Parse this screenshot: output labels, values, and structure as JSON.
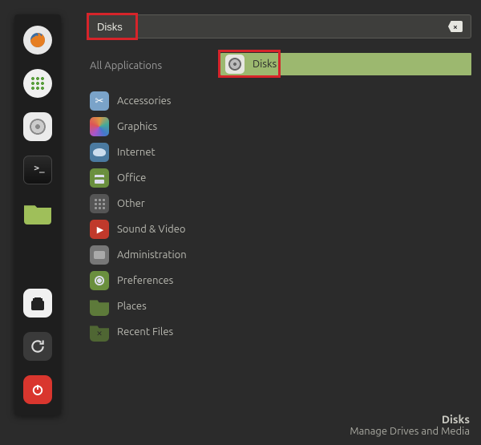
{
  "search": {
    "value": "Disks"
  },
  "categories": [
    {
      "label": "All Applications",
      "icon": ""
    },
    {
      "label": "Accessories",
      "icon": "i-scissors"
    },
    {
      "label": "Graphics",
      "icon": "i-graphics"
    },
    {
      "label": "Internet",
      "icon": "i-internet"
    },
    {
      "label": "Office",
      "icon": "i-office"
    },
    {
      "label": "Other",
      "icon": "i-other"
    },
    {
      "label": "Sound & Video",
      "icon": "i-sound"
    },
    {
      "label": "Administration",
      "icon": "i-admin"
    },
    {
      "label": "Preferences",
      "icon": "i-prefs"
    },
    {
      "label": "Places",
      "icon": "i-places"
    },
    {
      "label": "Recent Files",
      "icon": "i-recent"
    }
  ],
  "results": [
    {
      "label": "Disks",
      "icon": "i-disks-app"
    }
  ],
  "tooltip": {
    "title": "Disks",
    "desc": "Manage Drives and Media"
  }
}
